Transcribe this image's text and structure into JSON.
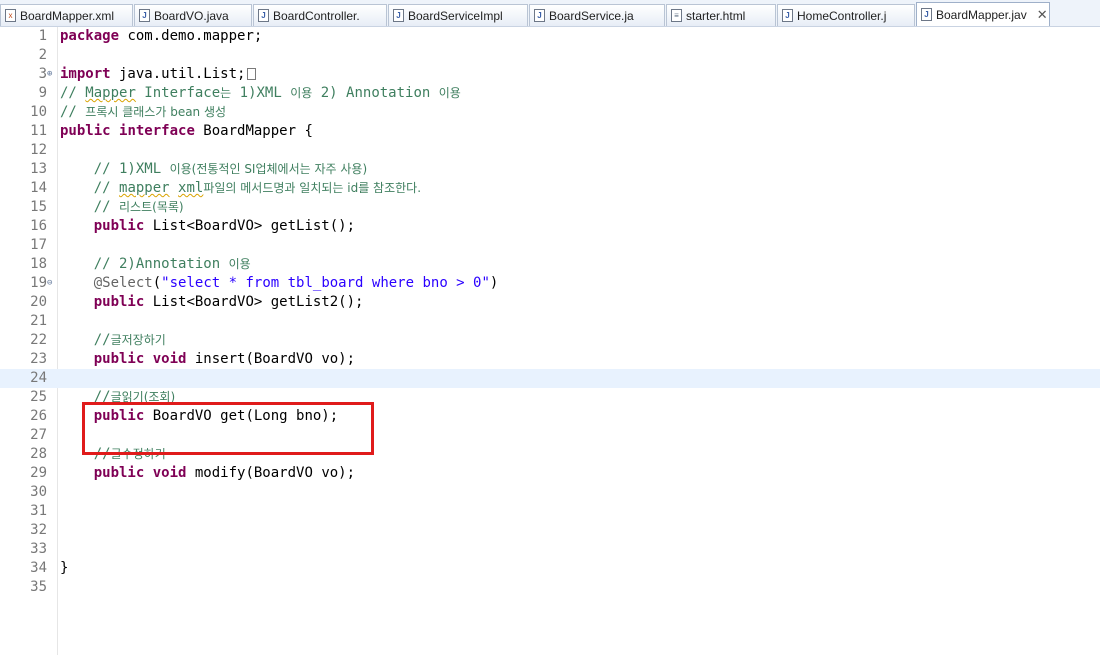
{
  "tabs": [
    {
      "label": "BoardMapper.xml",
      "icon": "xml"
    },
    {
      "label": "BoardVO.java",
      "icon": "java"
    },
    {
      "label": "BoardController.",
      "icon": "java"
    },
    {
      "label": "BoardServiceImpl",
      "icon": "java"
    },
    {
      "label": "BoardService.ja",
      "icon": "java"
    },
    {
      "label": "starter.html",
      "icon": "html"
    },
    {
      "label": "HomeController.j",
      "icon": "java"
    },
    {
      "label": "BoardMapper.jav",
      "icon": "java",
      "active": true,
      "close": "✕"
    }
  ],
  "editor": {
    "current_line": 24,
    "highlighted_lines": [
      25,
      26
    ],
    "lines": [
      {
        "n": "1",
        "tokens": [
          [
            "kw",
            "package"
          ],
          [
            "",
            " com.demo.mapper;"
          ]
        ]
      },
      {
        "n": "2",
        "tokens": []
      },
      {
        "n": "3",
        "fold": "⊕",
        "tokens": [
          [
            "kw",
            "import"
          ],
          [
            "",
            " java.util.List;"
          ]
        ],
        "collapsed": true
      },
      {
        "n": "9",
        "tokens": [
          [
            "cm",
            "// "
          ],
          [
            "cm sq",
            "Mapper"
          ],
          [
            "cm",
            " Interface"
          ],
          [
            "cm kr",
            "는"
          ],
          [
            "cm",
            " 1)XML "
          ],
          [
            "cm kr",
            "이용"
          ],
          [
            "cm",
            " 2) Annotation "
          ],
          [
            "cm kr",
            "이용"
          ]
        ]
      },
      {
        "n": "10",
        "tokens": [
          [
            "cm",
            "// "
          ],
          [
            "cm kr",
            "프록시 클래스가 bean 생성"
          ]
        ]
      },
      {
        "n": "11",
        "tokens": [
          [
            "kw",
            "public"
          ],
          [
            "",
            " "
          ],
          [
            "kw",
            "interface"
          ],
          [
            "",
            " BoardMapper {"
          ]
        ]
      },
      {
        "n": "12",
        "tokens": []
      },
      {
        "n": "13",
        "tokens": [
          [
            "",
            "    "
          ],
          [
            "cm",
            "// 1)XML "
          ],
          [
            "cm kr",
            "이용(전통적인 SI업체에서는 자주 사용)"
          ]
        ]
      },
      {
        "n": "14",
        "tokens": [
          [
            "",
            "    "
          ],
          [
            "cm",
            "// "
          ],
          [
            "cm sq",
            "mapper"
          ],
          [
            "cm",
            " "
          ],
          [
            "cm sq",
            "xml"
          ],
          [
            "cm kr",
            "파일의 메서드명과 일치되는 id를 참조한다."
          ]
        ]
      },
      {
        "n": "15",
        "tokens": [
          [
            "",
            "    "
          ],
          [
            "cm",
            "// "
          ],
          [
            "cm kr",
            "리스트(목록)"
          ]
        ]
      },
      {
        "n": "16",
        "tokens": [
          [
            "",
            "    "
          ],
          [
            "kw",
            "public"
          ],
          [
            "",
            " List<BoardVO> getList();"
          ]
        ]
      },
      {
        "n": "17",
        "tokens": []
      },
      {
        "n": "18",
        "tokens": [
          [
            "",
            "    "
          ],
          [
            "cm",
            "// 2)Annotation "
          ],
          [
            "cm kr",
            "이용"
          ]
        ]
      },
      {
        "n": "19",
        "fold": "⊖",
        "tokens": [
          [
            "",
            "    "
          ],
          [
            "ann",
            "@Select"
          ],
          [
            "",
            "("
          ],
          [
            "str",
            "\"select * from tbl_board where bno > 0\""
          ],
          [
            "",
            ")"
          ]
        ]
      },
      {
        "n": "20",
        "tokens": [
          [
            "",
            "    "
          ],
          [
            "kw",
            "public"
          ],
          [
            "",
            " List<BoardVO> getList2();"
          ]
        ]
      },
      {
        "n": "21",
        "tokens": []
      },
      {
        "n": "22",
        "tokens": [
          [
            "",
            "    "
          ],
          [
            "cm",
            "//"
          ],
          [
            "cm kr",
            "글저장하기"
          ]
        ]
      },
      {
        "n": "23",
        "tokens": [
          [
            "",
            "    "
          ],
          [
            "kw",
            "public"
          ],
          [
            "",
            " "
          ],
          [
            "kw",
            "void"
          ],
          [
            "",
            " insert(BoardVO vo);"
          ]
        ]
      },
      {
        "n": "24",
        "tokens": []
      },
      {
        "n": "25",
        "tokens": [
          [
            "",
            "    "
          ],
          [
            "cm",
            "//"
          ],
          [
            "cm kr",
            "글읽기(조회)"
          ]
        ]
      },
      {
        "n": "26",
        "tokens": [
          [
            "",
            "    "
          ],
          [
            "kw",
            "public"
          ],
          [
            "",
            " BoardVO get(Long bno);"
          ]
        ]
      },
      {
        "n": "27",
        "tokens": []
      },
      {
        "n": "28",
        "tokens": [
          [
            "",
            "    "
          ],
          [
            "cm",
            "//"
          ],
          [
            "cm kr",
            "글수정하기"
          ]
        ]
      },
      {
        "n": "29",
        "tokens": [
          [
            "",
            "    "
          ],
          [
            "kw",
            "public"
          ],
          [
            "",
            " "
          ],
          [
            "kw",
            "void"
          ],
          [
            "",
            " modify(BoardVO vo);"
          ]
        ]
      },
      {
        "n": "30",
        "tokens": []
      },
      {
        "n": "31",
        "tokens": []
      },
      {
        "n": "32",
        "tokens": []
      },
      {
        "n": "33",
        "tokens": []
      },
      {
        "n": "34",
        "tokens": [
          [
            "",
            "}"
          ]
        ]
      },
      {
        "n": "35",
        "tokens": []
      }
    ]
  },
  "colors": {
    "keyword": "#7f0055",
    "comment": "#3f7f5f",
    "string": "#2a00ff",
    "annotation": "#646464",
    "highlight_box": "#e01b1b",
    "current_line_bg": "#e8f2fe"
  }
}
